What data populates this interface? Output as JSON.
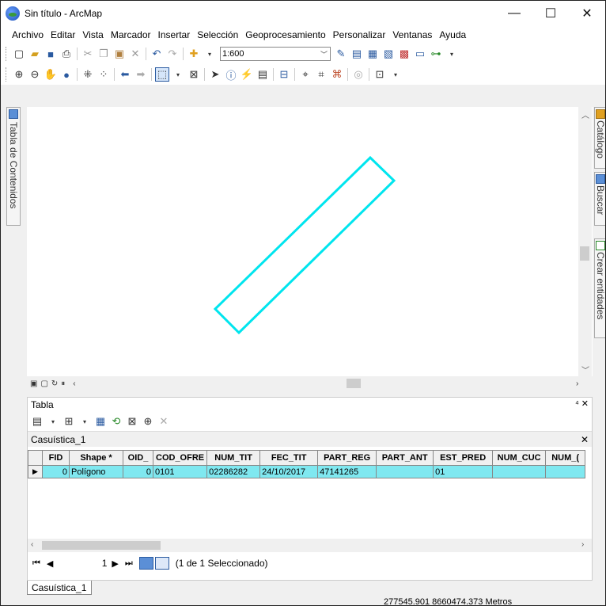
{
  "window": {
    "title": "Sin título - ArcMap",
    "minimize": "—",
    "maximize": "☐",
    "close": "✕"
  },
  "menu": [
    "Archivo",
    "Editar",
    "Vista",
    "Marcador",
    "Insertar",
    "Selección",
    "Geoprocesamiento",
    "Personalizar",
    "Ventanas",
    "Ayuda"
  ],
  "toolbar": {
    "scale_value": "1:600"
  },
  "docks": {
    "left": "Tabla de Contenidos",
    "right": [
      "Catálogo",
      "Buscar",
      "Crear entidades"
    ]
  },
  "map": {
    "feature_color": "#00e5ee"
  },
  "table_panel": {
    "title": "Tabla",
    "pin": "⁴ ✕",
    "subtab": "Casuística_1",
    "columns": [
      "FID",
      "Shape *",
      "OID_",
      "COD_OFRE",
      "NUM_TIT",
      "FEC_TIT",
      "PART_REG",
      "PART_ANT",
      "EST_PRED",
      "NUM_CUC",
      "NUM_("
    ],
    "rows": [
      [
        "0",
        "Polígono",
        "0",
        "0101",
        "02286282",
        "24/10/2017",
        "47141265",
        "",
        "01",
        "",
        ""
      ]
    ],
    "selection_color": "#7fe8f0",
    "record_position": "1",
    "selection_status": "(1 de 1 Seleccionado)"
  },
  "bottom_tab": "Casuística_1",
  "status": {
    "coordinates": "277545.901  8660474.373 Metros"
  }
}
